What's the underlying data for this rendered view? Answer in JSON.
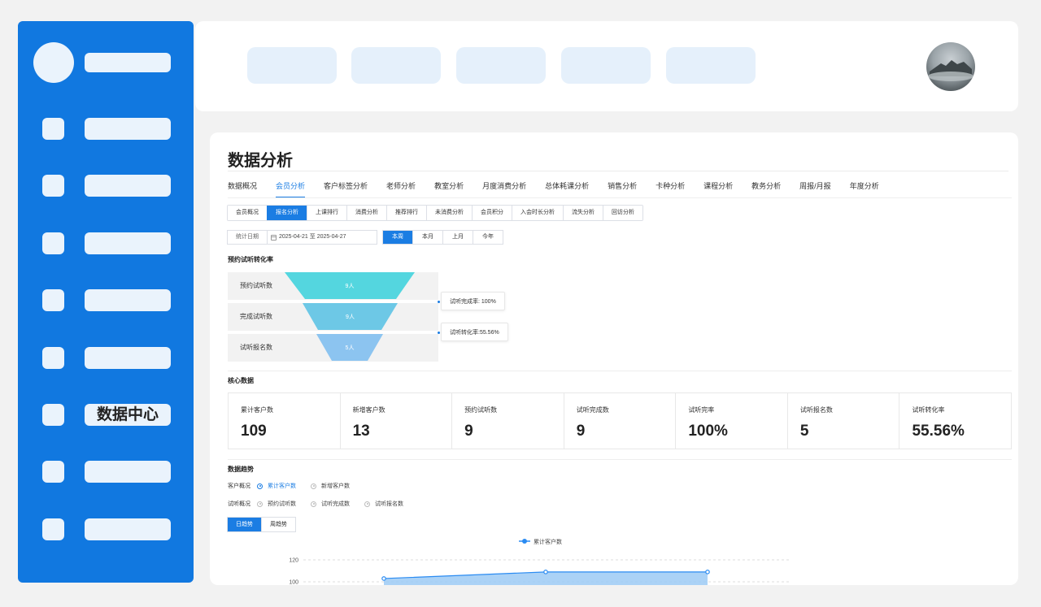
{
  "sidebar": {
    "items": [
      {
        "label": ""
      },
      {
        "label": ""
      },
      {
        "label": ""
      },
      {
        "label": ""
      },
      {
        "label": ""
      },
      {
        "label": "数据中心"
      },
      {
        "label": ""
      },
      {
        "label": ""
      }
    ]
  },
  "page": {
    "title": "数据分析",
    "tabs": [
      "数据概况",
      "会员分析",
      "客户标签分析",
      "老师分析",
      "教室分析",
      "月度消费分析",
      "总体耗课分析",
      "销售分析",
      "卡种分析",
      "课程分析",
      "教务分析",
      "周报/月报",
      "年度分析"
    ],
    "active_tab": 1,
    "subtabs": [
      "会员概况",
      "报名分析",
      "上课排行",
      "消费分析",
      "推荐排行",
      "未消费分析",
      "会员积分",
      "入会时长分析",
      "流失分析",
      "回访分析"
    ],
    "active_subtab": 1
  },
  "filters": {
    "date_label": "统计日期",
    "date_range": "2025-04-21 至 2025-04-27",
    "periods": [
      "本周",
      "本月",
      "上月",
      "今年"
    ],
    "active_period": 0
  },
  "funnel": {
    "title": "预约试听转化率",
    "stages": [
      {
        "label": "预约试听数",
        "value": "9人"
      },
      {
        "label": "完成试听数",
        "value": "9人"
      },
      {
        "label": "试听报名数",
        "value": "5人"
      }
    ],
    "callouts": [
      "试听完成率: 100%",
      "试听转化率:55.56%"
    ],
    "colors": [
      "#54d6df",
      "#6dc8e6",
      "#8cc4f0"
    ]
  },
  "core": {
    "title": "核心数据",
    "metrics": [
      {
        "label": "累计客户数",
        "value": "109"
      },
      {
        "label": "新增客户数",
        "value": "13"
      },
      {
        "label": "预约试听数",
        "value": "9"
      },
      {
        "label": "试听完成数",
        "value": "9"
      },
      {
        "label": "试听完率",
        "value": "100%"
      },
      {
        "label": "试听报名数",
        "value": "5"
      },
      {
        "label": "试听转化率",
        "value": "55.56%"
      }
    ]
  },
  "trend": {
    "title": "数据趋势",
    "customer_group": {
      "label": "客户概况",
      "options": [
        "累计客户数",
        "新增客户数"
      ],
      "checked": 0
    },
    "trial_group": {
      "label": "试听概况",
      "options": [
        "预约试听数",
        "试听完成数",
        "试听报名数"
      ],
      "checked": -1
    },
    "toggles": [
      "日趋势",
      "周趋势"
    ],
    "active_toggle": 0
  },
  "chart_data": {
    "type": "area",
    "series": [
      {
        "name": "累计客户数",
        "values": [
          103,
          109,
          109
        ]
      }
    ],
    "yticks": [
      100,
      120
    ],
    "ylim": [
      100,
      120
    ],
    "legend_position": "top-center",
    "grid": true,
    "color": "#2a8bf2"
  }
}
